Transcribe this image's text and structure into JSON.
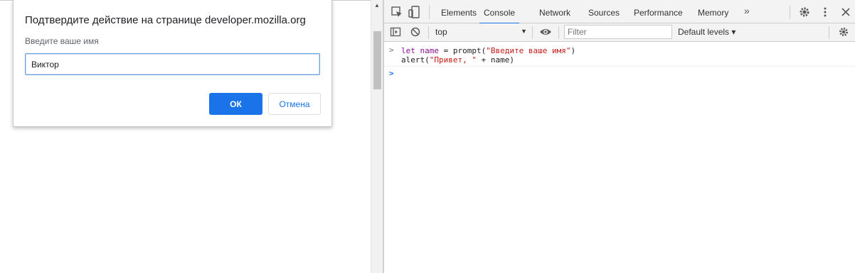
{
  "dialog": {
    "title": "Подтвердите действие на странице developer.mozilla.org",
    "message": "Введите ваше имя",
    "input_value": "Виктор",
    "ok_label": "ОК",
    "cancel_label": "Отмена"
  },
  "devtools": {
    "tabs": [
      "Elements",
      "Console",
      "Network",
      "Sources",
      "Performance",
      "Memory"
    ],
    "active_tab": "Console",
    "more_tabs": "»",
    "toolbar": {
      "context": "top",
      "filter_placeholder": "Filter",
      "levels": "Default levels ▾"
    },
    "console": {
      "input_line1_prefix": "let ",
      "input_line1_var": "name",
      "input_line1_mid": " = prompt(",
      "input_line1_str": "\"Введите ваше имя\"",
      "input_line1_end": ")",
      "input_line2_prefix": "alert(",
      "input_line2_str": "\"Привет, \"",
      "input_line2_end": " + name)"
    }
  },
  "colors": {
    "accent": "#1a73e8",
    "string": "#c41a16",
    "keyword": "#881391"
  }
}
